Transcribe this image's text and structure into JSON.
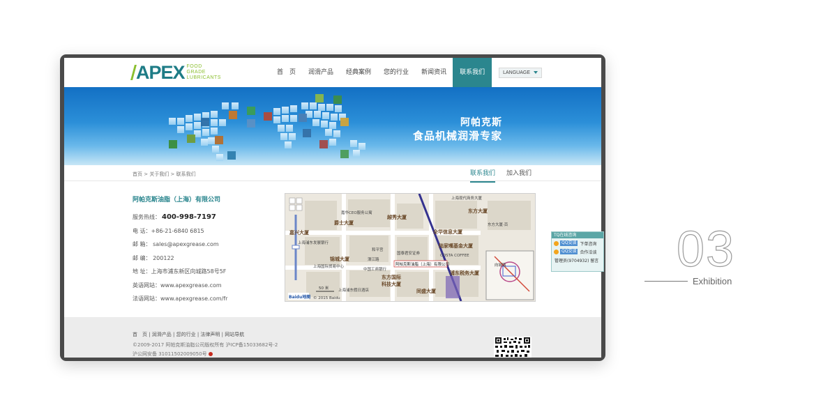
{
  "logo": {
    "word": "APEX",
    "tagline": [
      "FOOD",
      "GRADE",
      "LUBRICANTS"
    ]
  },
  "nav": {
    "items": [
      {
        "label": "首　页",
        "active": false
      },
      {
        "label": "润滑产品",
        "active": false
      },
      {
        "label": "经典案例",
        "active": false
      },
      {
        "label": "您的行业",
        "active": false
      },
      {
        "label": "新闻资讯",
        "active": false
      },
      {
        "label": "联系我们",
        "active": true
      }
    ],
    "language": "LANGUAGE"
  },
  "banner": {
    "line1": "阿帕克斯",
    "line2": "食品机械润滑专家"
  },
  "breadcrumb": "首页 > 关于我们 > 联系我们",
  "subtabs": [
    "联系我们",
    "加入我们"
  ],
  "contact": {
    "company": "阿帕克斯油脂（上海）有限公司",
    "hotline_label": "服务热线：",
    "hotline": "400-998-7197",
    "tel": "电  话：+86-21-6840 6815",
    "email": "邮  箱： sales@apexgrease.com",
    "zip": "邮  编： 200122",
    "address": "地  址：上海市浦东新区向城路58号5F",
    "en_site": "英语网站：www.apexgrease.com",
    "fr_site": "法语网站：www.apexgrease.com/fr"
  },
  "map": {
    "labels": [
      "上海现代商务大厦",
      "嘉华CEO服务公寓",
      "东方大厦",
      "爵士大厦",
      "越秀大厦",
      "嘉兴大厦",
      "全华信息大厦",
      "东方大厦·百",
      "上海浦东发展银行",
      "陆家嘴基金大厦",
      "锦城大厦",
      "潭江路",
      "和平宫",
      "国泰君安证券",
      "上海国际贸易中心",
      "中国工商银行",
      "COSTA COFFEE",
      "阿帕克斯油脂（上海）有限公司",
      "东方国际科技大厦",
      "浦东税务大厦",
      "同盛大厦",
      "上海浦东假日酒店",
      "向城路"
    ],
    "scale": "50 米",
    "copyright": "© 2015 Baidu",
    "brand": "Baidu地图"
  },
  "footer": {
    "links": "首　页  |  润滑产品  |  您的行业  |  法律声明  |  网站导航",
    "copyright": "©2009-2017 阿帕克斯油脂公司版权所有 沪ICP备15033682号-2",
    "icp": "沪公网安备 31011502009050号"
  },
  "qq_widget": {
    "title": "TQ在线咨询",
    "rows": [
      {
        "button": "QQ交谈",
        "text": "下单咨询"
      },
      {
        "button": "QQ交谈",
        "text": "合作洽谈"
      }
    ],
    "admin": "管理员(9704932)   留言"
  },
  "exhibition": {
    "number": "03",
    "label": "Exhibition"
  },
  "colors": {
    "brand_teal": "#2b868e",
    "logo_green": "#8bbf2f",
    "banner_blue": "#1370c4"
  }
}
